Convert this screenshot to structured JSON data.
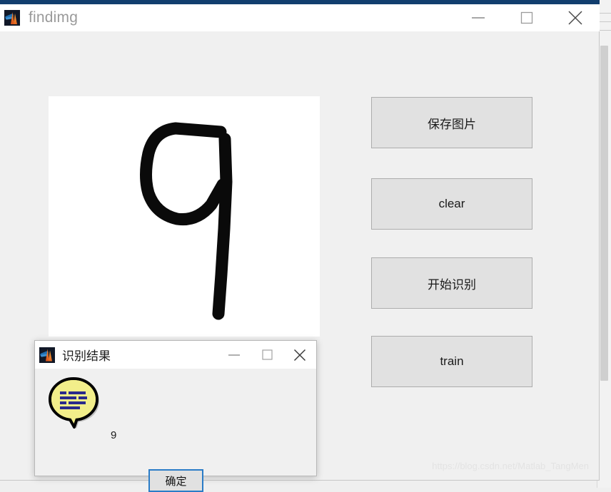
{
  "window": {
    "title": "findimg",
    "app_icon": "matlab-icon",
    "accent_color": "#123e6e",
    "background_color": "#f0f0f0",
    "titlebar_color": "#ffffff",
    "controls": [
      {
        "name": "minimize",
        "glyph": "minimize-icon"
      },
      {
        "name": "maximize",
        "glyph": "maximize-icon"
      },
      {
        "name": "close",
        "glyph": "close-icon"
      }
    ]
  },
  "canvas": {
    "name": "digit-drawing-canvas",
    "background_color": "#ffffff",
    "stroke_color": "#000000",
    "drawn_digit": "9"
  },
  "buttons": [
    {
      "id": "save",
      "label": "保存图片"
    },
    {
      "id": "clear",
      "label": "clear"
    },
    {
      "id": "recog",
      "label": "开始识别"
    },
    {
      "id": "train",
      "label": "train"
    }
  ],
  "dialog": {
    "title": "识别结果",
    "app_icon": "matlab-icon",
    "icon": "speech-bubble-icon",
    "icon_colors": {
      "fill": "#f2ee8a",
      "outline": "#000000",
      "lines": "#2a2a8c"
    },
    "message": "9",
    "ok_label": "确定",
    "focus_color": "#2a7cc7",
    "controls": [
      {
        "name": "minimize",
        "glyph": "minimize-icon"
      },
      {
        "name": "maximize",
        "glyph": "maximize-icon"
      },
      {
        "name": "close",
        "glyph": "close-icon"
      }
    ]
  },
  "watermark": {
    "text": "https://blog.csdn.net/Matlab_TangMen"
  }
}
